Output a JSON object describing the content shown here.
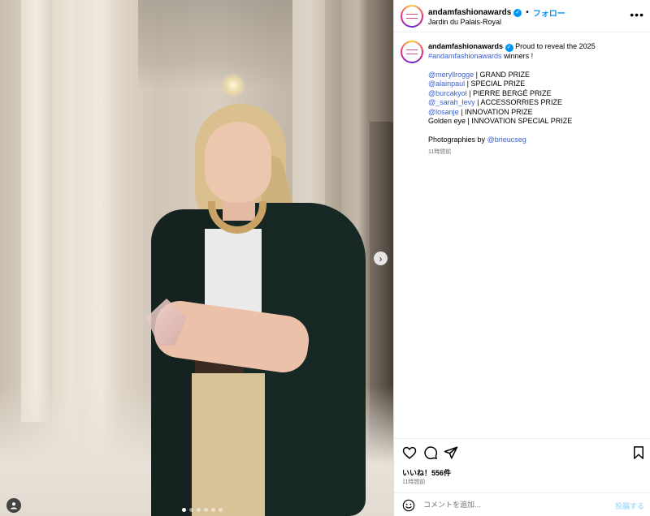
{
  "post": {
    "username": "andamfashionawards",
    "verified": true,
    "separator": "•",
    "follow_label": "フォロー",
    "location": "Jardin du Palais-Royal",
    "more_icon": "more-horizontal-icon"
  },
  "caption": {
    "username": "andamfashionawards",
    "intro": "Proud to reveal the 2025",
    "hashtag": "#andamfashionawards",
    "intro_end": "winners !",
    "winners": [
      {
        "handle": "@meryllrogge",
        "prize": " | GRAND PRIZE"
      },
      {
        "handle": "@alainpaul",
        "prize": " | SPECIAL PRIZE"
      },
      {
        "handle": "@burcakyol",
        "prize": " | PIERRE BERGÉ PRIZE"
      },
      {
        "handle": "@_sarah_levy",
        "prize": " | ACCESSORRIES PRIZE"
      },
      {
        "handle": "@losanje",
        "prize": " | INNOVATION PRIZE"
      }
    ],
    "golden_eye": "Golden eye | INNOVATION SPECIAL PRIZE",
    "photo_credit_prefix": "Photographies by",
    "photo_credit_handle": "@brieucseg",
    "time": "11時間前"
  },
  "media": {
    "carousel_count": 6,
    "active_index": 0,
    "next_icon": "chevron-right-icon",
    "user_tag_icon": "user-tag-icon"
  },
  "actions": {
    "like_icon": "heart-icon",
    "comment_icon": "comment-icon",
    "share_icon": "send-icon",
    "save_icon": "bookmark-icon",
    "likes_text": "いいね！556件",
    "time": "11時間前"
  },
  "comment": {
    "placeholder": "コメントを追加...",
    "post_label": "投稿する"
  },
  "colors": {
    "link": "#3a5fcf",
    "accent": "#0095f6",
    "muted": "#737373"
  }
}
